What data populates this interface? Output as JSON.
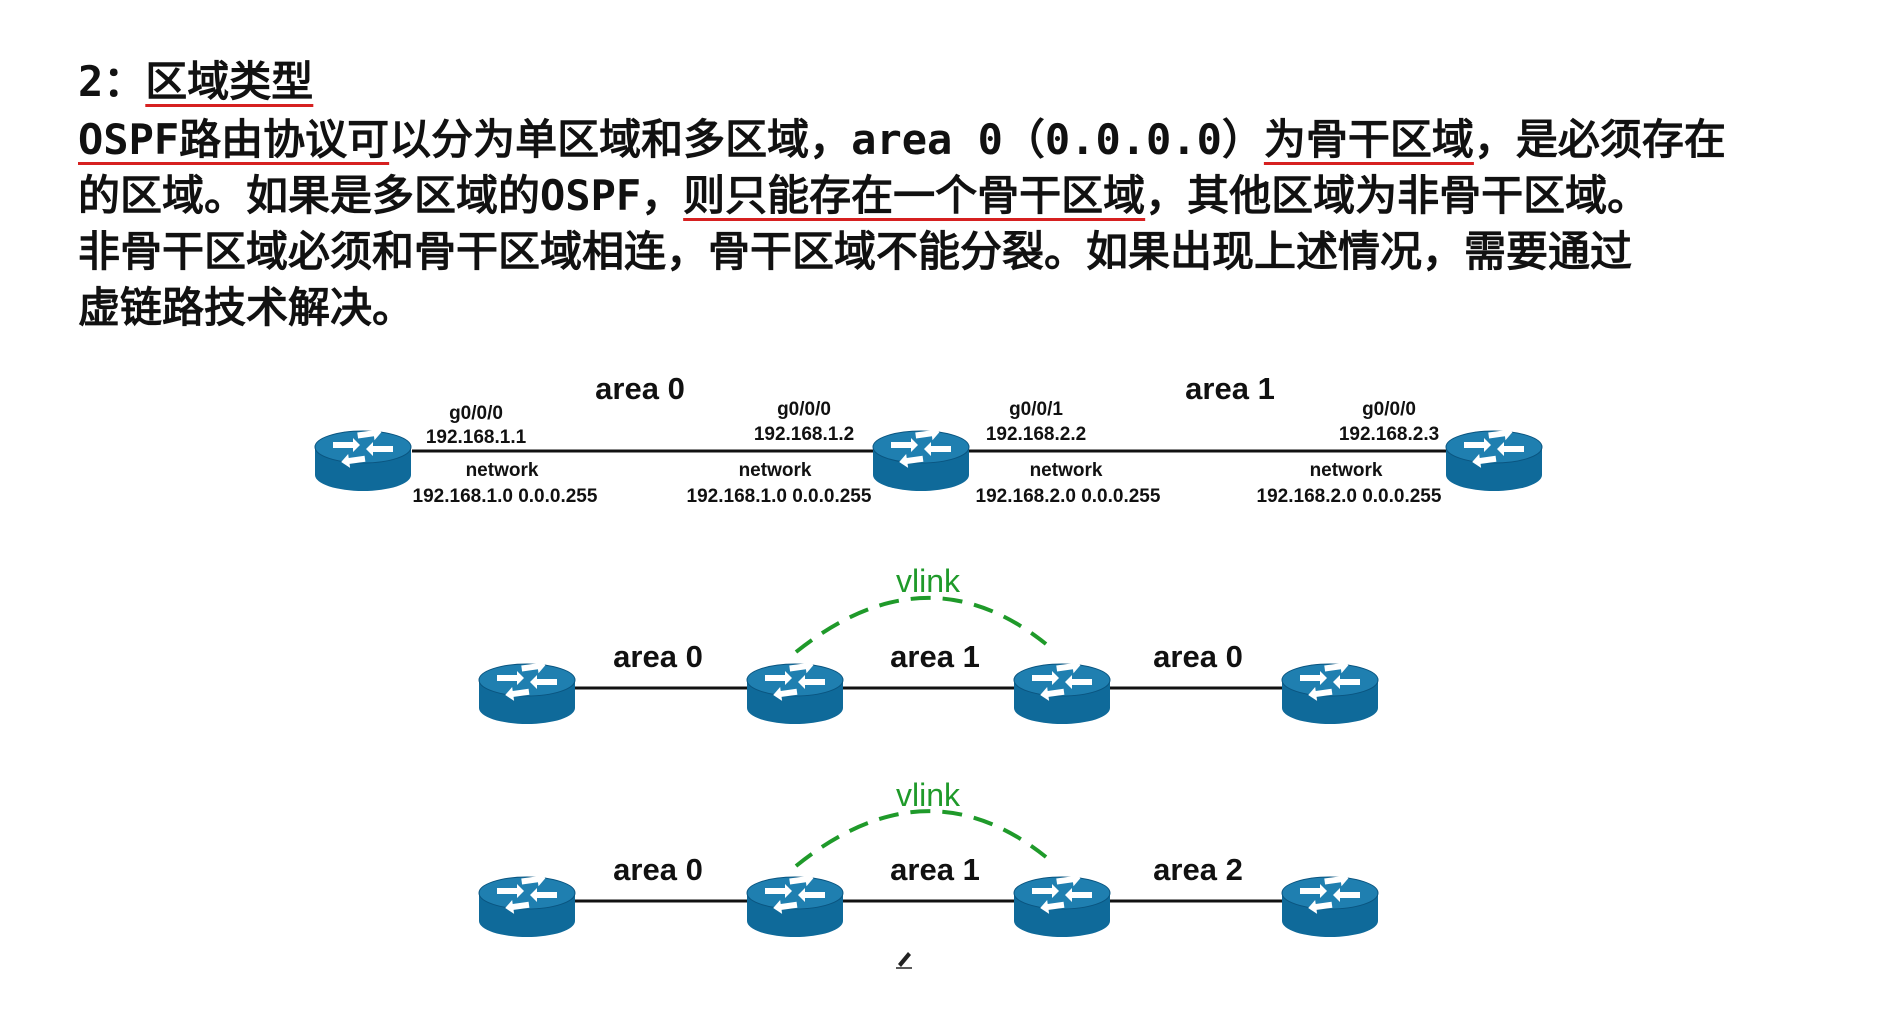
{
  "heading": {
    "number": "2：",
    "title": "区域类型"
  },
  "paragraph": {
    "line1_a": "OSPF路由协议可",
    "line1_b": "以分为单区域和多区域，area 0（0.0.0.0）",
    "line1_c": "为骨干区域",
    "line1_d": "，是必须存在",
    "line2_a": "的区域。如果是多区域的OSPF，",
    "line2_b": "则只能存在一个骨干区域",
    "line2_c": "，其他区域为非骨干区域。",
    "line3": "非骨干区域必须和骨干区域相连，骨干区域不能分裂。如果出现上述情况，需要通过",
    "line4": "虚链路技术解决。"
  },
  "diagram1": {
    "area_left": "area 0",
    "area_right": "area 1",
    "r1_if": "g0/0/0",
    "r1_ip": "192.168.1.1",
    "r2_if_left": "g0/0/0",
    "r2_ip_left": "192.168.1.2",
    "r2_if_right": "g0/0/1",
    "r2_ip_right": "192.168.2.2",
    "r3_if": "g0/0/0",
    "r3_ip": "192.168.2.3",
    "net_label": "network",
    "net1": "192.168.1.0 0.0.0.255",
    "net2": "192.168.1.0 0.0.0.255",
    "net3": "192.168.2.0 0.0.0.255",
    "net4": "192.168.2.0 0.0.0.255"
  },
  "diagram2": {
    "vlink": "vlink",
    "area_a": "area 0",
    "area_b": "area 1",
    "area_c": "area 0"
  },
  "diagram3": {
    "vlink": "vlink",
    "area_a": "area 0",
    "area_b": "area 1",
    "area_c": "area 2"
  },
  "colors": {
    "router": "#0f6a9a",
    "router_top": "#1f7fb0",
    "vlink": "#1f9a2a",
    "underline": "#d62020",
    "text": "#111111"
  },
  "icons": [
    "router-icon",
    "pen-cursor-icon"
  ]
}
